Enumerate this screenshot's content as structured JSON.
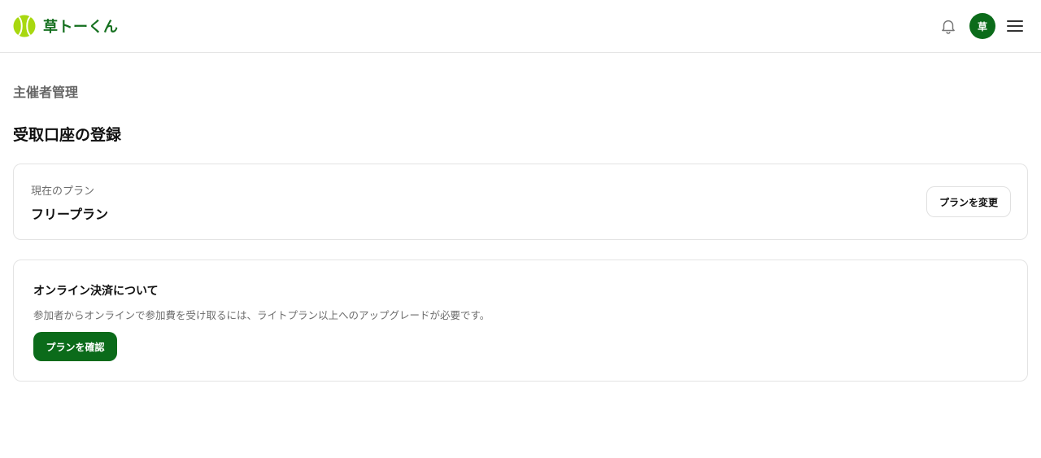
{
  "header": {
    "logo_text": "草トーくん",
    "avatar_initial": "草",
    "colors": {
      "brand_green": "#15701f",
      "avatar_bg": "#0b6b1a",
      "ball": "#a8d80f"
    },
    "icons": [
      "tennis-ball-logo-icon",
      "bell-icon",
      "hamburger-menu-icon"
    ]
  },
  "page": {
    "section_title": "主催者管理",
    "title": "受取口座の登録"
  },
  "plan_card": {
    "label": "現在のプラン",
    "plan_name": "フリープラン",
    "change_button": "プランを変更"
  },
  "info_card": {
    "title": "オンライン決済について",
    "description": "参加者からオンラインで参加費を受け取るには、ライトプラン以上へのアップグレードが必要です。",
    "confirm_button": "プランを確認"
  }
}
